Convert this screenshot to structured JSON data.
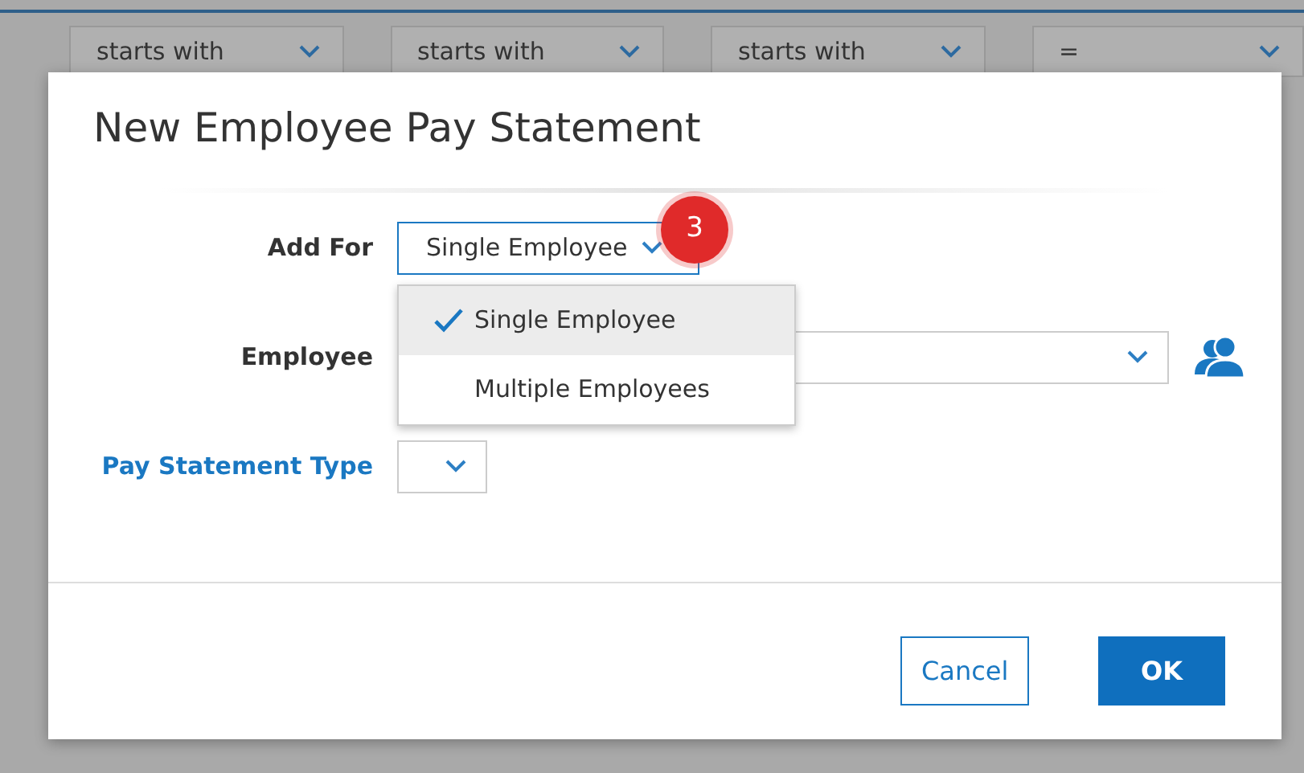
{
  "filter_row": [
    {
      "value": "starts with"
    },
    {
      "value": "starts with"
    },
    {
      "value": "starts with"
    },
    {
      "value": "="
    }
  ],
  "dialog": {
    "title": "New Employee Pay Statement",
    "fields": [
      {
        "label": "Add For",
        "kind": "select",
        "label_link": false,
        "value": "Single Employee",
        "expanded": true,
        "badge": "3",
        "options": [
          {
            "label": "Single Employee",
            "selected": true
          },
          {
            "label": "Multiple Employees",
            "selected": false
          }
        ]
      },
      {
        "label": "Employee",
        "kind": "lookup",
        "label_link": false,
        "expanded": false
      },
      {
        "label": "Pay Statement Type",
        "kind": "small-select",
        "label_link": true,
        "expanded": false
      }
    ],
    "buttons": [
      {
        "label": "Cancel",
        "kind": "secondary"
      },
      {
        "label": "OK",
        "kind": "primary"
      }
    ]
  }
}
